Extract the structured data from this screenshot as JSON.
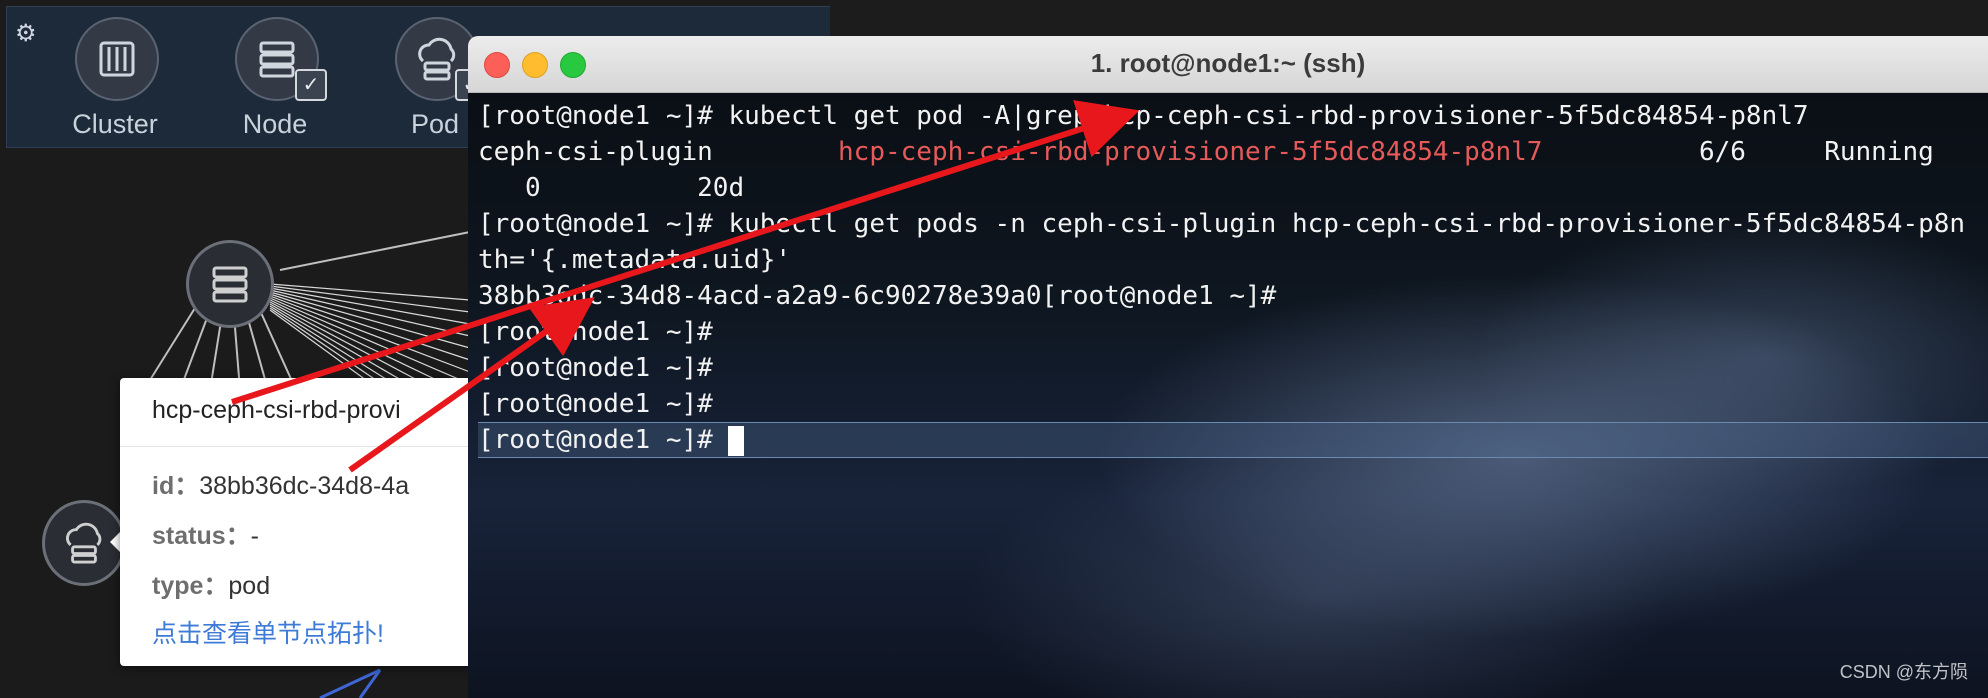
{
  "topology": {
    "settings_icon": "gear-icon",
    "toolbar": [
      {
        "label": "Cluster",
        "icon": "cluster-icon",
        "checked": false
      },
      {
        "label": "Node",
        "icon": "server-icon",
        "checked": true
      },
      {
        "label": "Pod",
        "icon": "cloud-server-icon",
        "checked": true
      }
    ],
    "tooltip": {
      "title": "hcp-ceph-csi-rbd-provi",
      "id_key": "id：",
      "id_val": "38bb36dc-34d8-4a",
      "status_key": "status：",
      "status_val": "-",
      "type_key": "type：",
      "type_val": "pod",
      "link": "点击查看单节点拓扑!"
    }
  },
  "terminal": {
    "title": "1. root@node1:~ (ssh)",
    "lines": [
      {
        "text": "[root@node1 ~]# kubectl get pod -A|grep hcp-ceph-csi-rbd-provisioner-5f5dc84854-p8nl7"
      },
      {
        "pre": "ceph-csi-plugin        ",
        "red": "hcp-ceph-csi-rbd-provisioner-5f5dc84854-p8nl7",
        "post": "          6/6     Running"
      },
      {
        "text": "   0          20d"
      },
      {
        "text": "[root@node1 ~]# kubectl get pods -n ceph-csi-plugin hcp-ceph-csi-rbd-provisioner-5f5dc84854-p8n"
      },
      {
        "text": "th='{.metadata.uid}'"
      },
      {
        "text": "38bb36dc-34d8-4acd-a2a9-6c90278e39a0[root@node1 ~]#"
      },
      {
        "text": "[root@node1 ~]#"
      },
      {
        "text": "[root@node1 ~]#"
      },
      {
        "text": "[root@node1 ~]#"
      }
    ],
    "prompt": "[root@node1 ~]# ",
    "watermark": "CSDN @东方陨"
  },
  "colors": {
    "annotation_arrow": "#e8171c",
    "highlight": "#e65a5a"
  }
}
